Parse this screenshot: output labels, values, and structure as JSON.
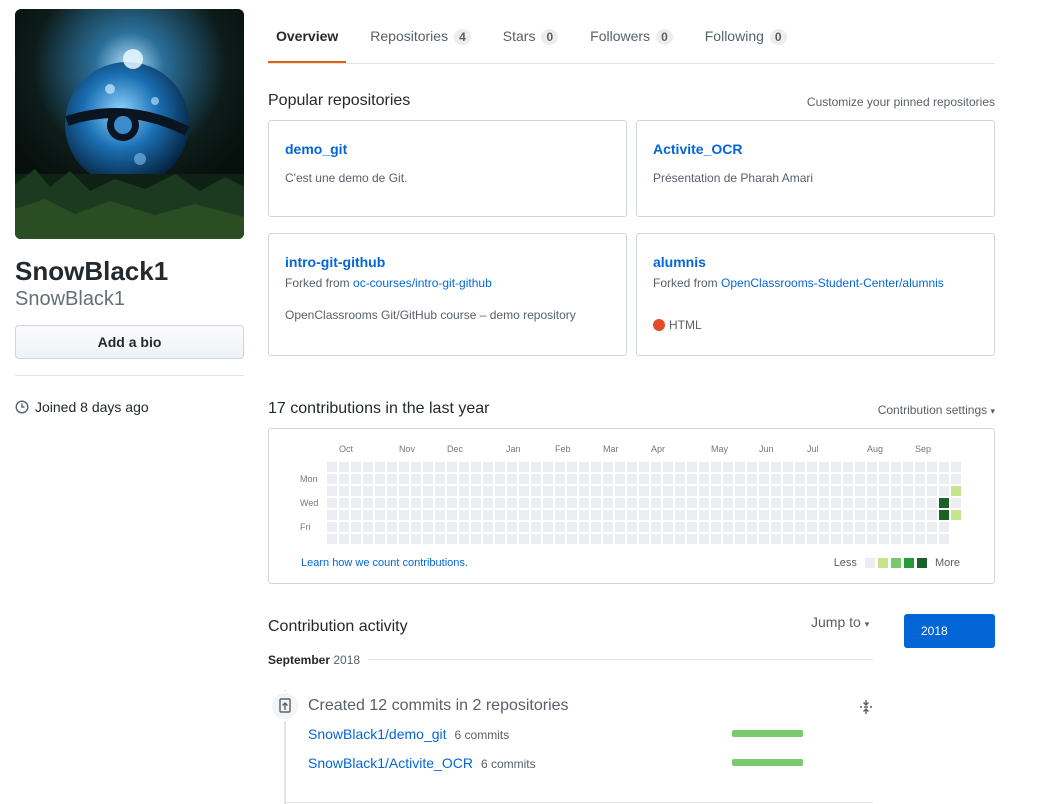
{
  "profile": {
    "name": "SnowBlack1",
    "login": "SnowBlack1",
    "bio_button": "Add a bio",
    "joined": "Joined 8 days ago"
  },
  "tabs": [
    {
      "label": "Overview",
      "count": null,
      "selected": true
    },
    {
      "label": "Repositories",
      "count": "4",
      "selected": false
    },
    {
      "label": "Stars",
      "count": "0",
      "selected": false
    },
    {
      "label": "Followers",
      "count": "0",
      "selected": false
    },
    {
      "label": "Following",
      "count": "0",
      "selected": false
    }
  ],
  "popular": {
    "title": "Popular repositories",
    "customize": "Customize your pinned repositories",
    "repos": [
      {
        "name": "demo_git",
        "description": "C'est une demo de Git."
      },
      {
        "name": "Activite_OCR",
        "description": "Présentation de Pharah Amari"
      },
      {
        "name": "intro-git-github",
        "fork_prefix": "Forked from ",
        "fork_source": "oc-courses/intro-git-github",
        "description": "OpenClassrooms Git/GitHub course – demo repository"
      },
      {
        "name": "alumnis",
        "fork_prefix": "Forked from ",
        "fork_source": "OpenClassrooms-Student-Center/alumnis",
        "language": "HTML",
        "language_color": "#e34c26"
      }
    ]
  },
  "contributions": {
    "title": "17 contributions in the last year",
    "settings": "Contribution settings",
    "months": [
      "Oct",
      "Nov",
      "Dec",
      "Jan",
      "Feb",
      "Mar",
      "Apr",
      "May",
      "Jun",
      "Jul",
      "Aug",
      "Sep"
    ],
    "days": [
      "Mon",
      "Wed",
      "Fri"
    ],
    "learn_link": "Learn how we count contributions.",
    "legend_less": "Less",
    "legend_more": "More",
    "colors": [
      "#ebedf0",
      "#c6e48b",
      "#7bc96f",
      "#239a3b",
      "#196127"
    ]
  },
  "activity": {
    "title": "Contribution activity",
    "jump_to": "Jump to",
    "year": "2018",
    "month": "September",
    "month_year": "2018",
    "summary": "Created 12 commits in 2 repositories",
    "rows": [
      {
        "repo": "SnowBlack1/demo_git",
        "count": "6 commits"
      },
      {
        "repo": "SnowBlack1/Activite_OCR",
        "count": "6 commits"
      }
    ]
  }
}
